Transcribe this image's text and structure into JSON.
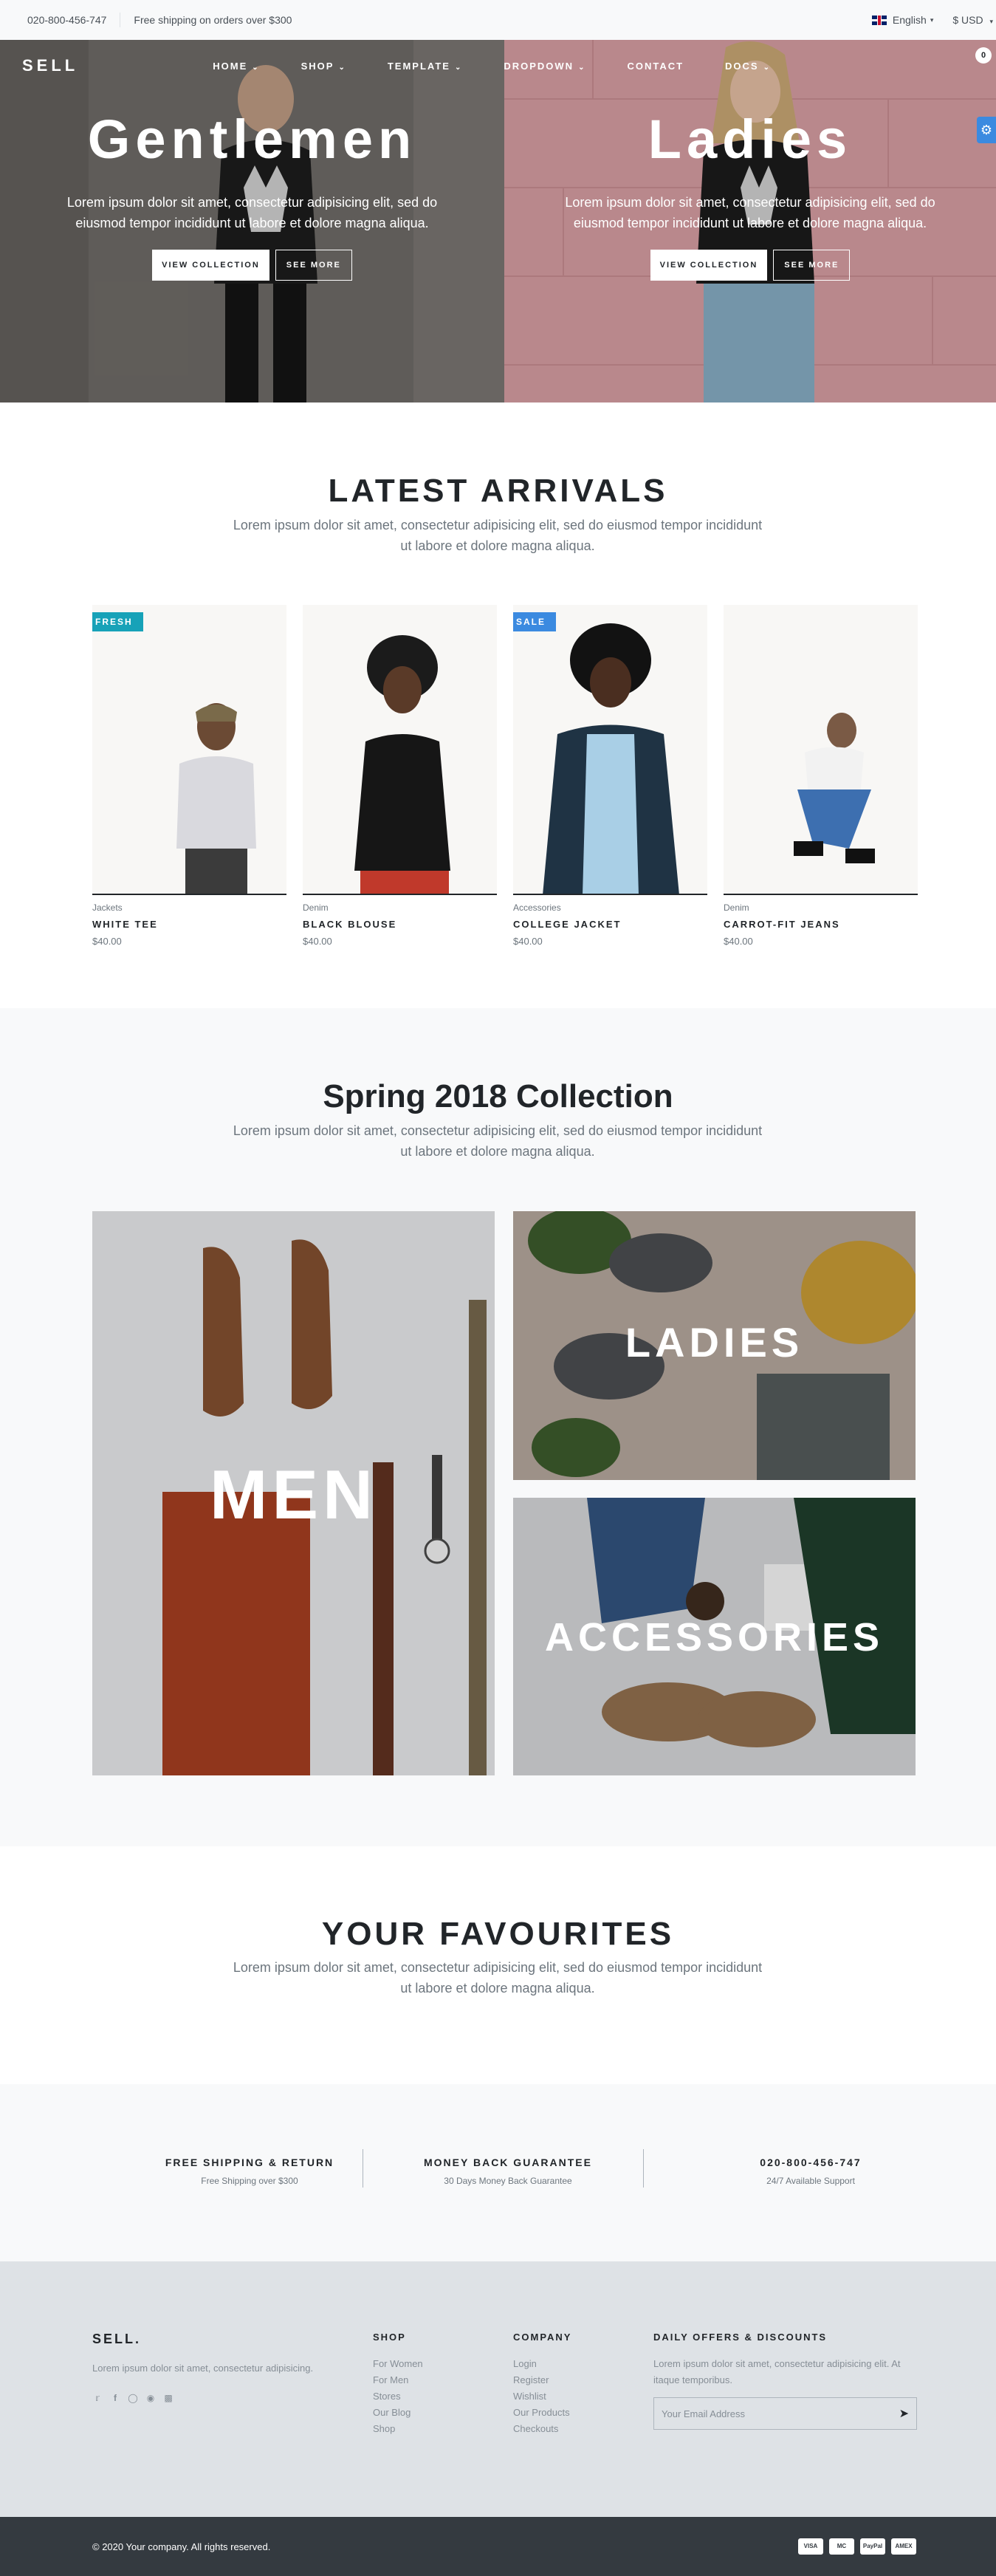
{
  "topbar": {
    "phone": "020-800-456-747",
    "shipping": "Free shipping on orders over $300",
    "language": "English",
    "currency": "$ USD"
  },
  "nav": {
    "brand": "SELL",
    "items": [
      "HOME",
      "SHOP",
      "TEMPLATE",
      "DROPDOWN",
      "CONTACT",
      "DOCS"
    ],
    "cart_count": "0"
  },
  "hero": {
    "left": {
      "title": "Gentlemen",
      "text": "Lorem ipsum dolor sit amet, consectetur adipisicing elit, sed do eiusmod tempor incididunt ut labore et dolore magna aliqua.",
      "btn_primary": "VIEW COLLECTION",
      "btn_secondary": "SEE MORE"
    },
    "right": {
      "title": "Ladies",
      "text": "Lorem ipsum dolor sit amet, consectetur adipisicing elit, sed do eiusmod tempor incididunt ut labore et dolore magna aliqua.",
      "btn_primary": "VIEW COLLECTION",
      "btn_secondary": "SEE MORE"
    }
  },
  "arrivals": {
    "title": "LATEST ARRIVALS",
    "lead": "Lorem ipsum dolor sit amet, consectetur adipisicing elit, sed do eiusmod tempor incididunt ut labore et dolore magna aliqua.",
    "products": [
      {
        "badge": "FRESH",
        "category": "Jackets",
        "name": "WHITE TEE",
        "price": "$40.00"
      },
      {
        "badge": "",
        "category": "Denim",
        "name": "BLACK BLOUSE",
        "price": "$40.00"
      },
      {
        "badge": "SALE",
        "category": "Accessories",
        "name": "COLLEGE JACKET",
        "price": "$40.00"
      },
      {
        "badge": "",
        "category": "Denim",
        "name": "CARROT-FIT JEANS",
        "price": "$40.00"
      }
    ]
  },
  "collection": {
    "title": "Spring 2018 Collection",
    "lead": "Lorem ipsum dolor sit amet, consectetur adipisicing elit, sed do eiusmod tempor incididunt ut labore et dolore magna aliqua.",
    "tiles": {
      "men": "MEN",
      "ladies": "LADIES",
      "accessories": "ACCESSORIES"
    }
  },
  "favourites": {
    "title": "YOUR FAVOURITES",
    "lead": "Lorem ipsum dolor sit amet, consectetur adipisicing elit, sed do eiusmod tempor incididunt ut labore et dolore magna aliqua."
  },
  "services": [
    {
      "title": "FREE SHIPPING & RETURN",
      "text": "Free Shipping over $300"
    },
    {
      "title": "MONEY BACK GUARANTEE",
      "text": "30 Days Money Back Guarantee"
    },
    {
      "title": "020-800-456-747",
      "text": "24/7 Available Support"
    }
  ],
  "footer": {
    "brand": "SELL.",
    "about": "Lorem ipsum dolor sit amet, consectetur adipisicing.",
    "shop": {
      "heading": "SHOP",
      "links": [
        "For Women",
        "For Men",
        "Stores",
        "Our Blog",
        "Shop"
      ]
    },
    "company": {
      "heading": "COMPANY",
      "links": [
        "Login",
        "Register",
        "Wishlist",
        "Our Products",
        "Checkouts"
      ]
    },
    "offers": {
      "heading": "DAILY OFFERS & DISCOUNTS",
      "text": "Lorem ipsum dolor sit amet, consectetur adipisicing elit. At itaque temporibus.",
      "email_placeholder": "Your Email Address"
    },
    "copyright": "© 2020 Your company. All rights reserved.",
    "payments": [
      "VISA",
      "MC",
      "PayPal",
      "AMEX"
    ]
  }
}
